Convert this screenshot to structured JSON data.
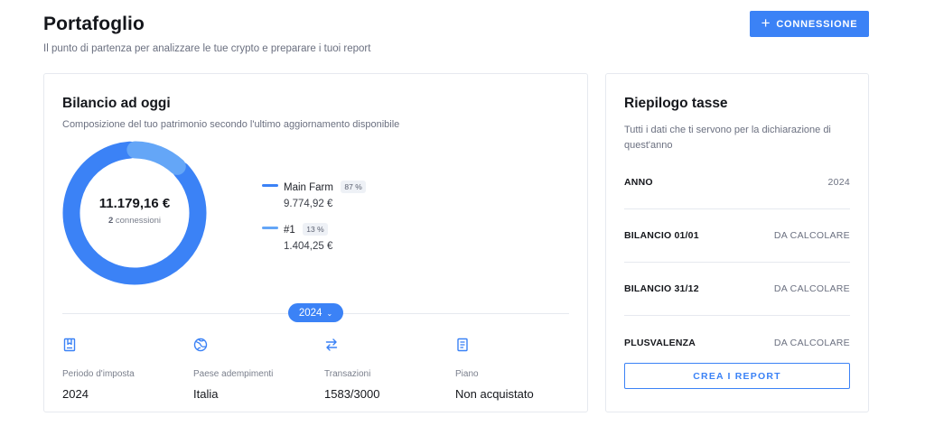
{
  "header": {
    "title": "Portafoglio",
    "subtitle": "Il punto di partenza per analizzare le tue crypto e preparare i tuoi report",
    "connect_label": "CONNESSIONE"
  },
  "balance": {
    "title": "Bilancio ad oggi",
    "description": "Composizione del tuo patrimonio secondo l'ultimo aggiornamento disponibile",
    "total": "11.179,16 €",
    "connections_count": "2",
    "connections_label": "connessioni",
    "year_selector": "2024",
    "chart_data": {
      "type": "pie",
      "categories": [
        "Main Farm",
        "#1"
      ],
      "values": [
        87,
        13
      ],
      "colors": [
        "#3b82f6",
        "#64a6f7"
      ]
    },
    "legend": [
      {
        "name": "Main Farm",
        "percent": "87 %",
        "value": "9.774,92 €",
        "color": "#3b82f6"
      },
      {
        "name": "#1",
        "percent": "13 %",
        "value": "1.404,25 €",
        "color": "#64a6f7"
      }
    ],
    "stats": [
      {
        "icon": "bookmark-icon",
        "label": "Periodo d'imposta",
        "value": "2024"
      },
      {
        "icon": "globe-icon",
        "label": "Paese adempimenti",
        "value": "Italia"
      },
      {
        "icon": "transfer-arrows-icon",
        "label": "Transazioni",
        "value": "1583/3000"
      },
      {
        "icon": "document-icon",
        "label": "Piano",
        "value": "Non acquistato"
      }
    ]
  },
  "tax": {
    "title": "Riepilogo tasse",
    "description": "Tutti i dati che ti servono per la dichiarazione di quest'anno",
    "rows": [
      {
        "key": "ANNO",
        "value": "2024"
      },
      {
        "key": "BILANCIO 01/01",
        "value": "DA CALCOLARE"
      },
      {
        "key": "BILANCIO 31/12",
        "value": "DA CALCOLARE"
      },
      {
        "key": "PLUSVALENZA",
        "value": "DA CALCOLARE"
      }
    ],
    "report_button": "CREA I REPORT"
  },
  "colors": {
    "accent": "#3b82f6",
    "accent_light": "#64a6f7"
  }
}
